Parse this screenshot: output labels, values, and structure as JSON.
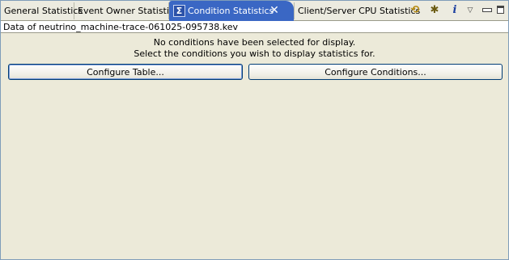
{
  "tabs": [
    {
      "label": "General Statistics"
    },
    {
      "label": "Event Owner Statistics"
    },
    {
      "label": "Condition Statistics",
      "active": true
    },
    {
      "label": "Client/Server CPU Statistics"
    }
  ],
  "toolbar": {
    "sync_icon": "sync-icon",
    "config_icon": "configure-icon",
    "info_icon": "info-icon",
    "menu_icon": "view-menu-icon",
    "minimize_icon": "minimize-icon",
    "maximize_icon": "maximize-icon"
  },
  "glyphs": {
    "sigma": "Σ",
    "close": "✕",
    "sync": "⟲",
    "config": "✱",
    "info": "i",
    "menu": "▽"
  },
  "content": {
    "data_file": "Data of neutrino_machine-trace-061025-095738.kev",
    "message_line1": "No conditions have been selected for display.",
    "message_line2": "Select the conditions you wish to display statistics for.",
    "configure_table_button": "Configure Table...",
    "configure_conditions_button": "Configure Conditions..."
  },
  "colors": {
    "active_tab": "#3a67c4",
    "panel_background": "#ecead9",
    "button_border": "#003c74"
  }
}
